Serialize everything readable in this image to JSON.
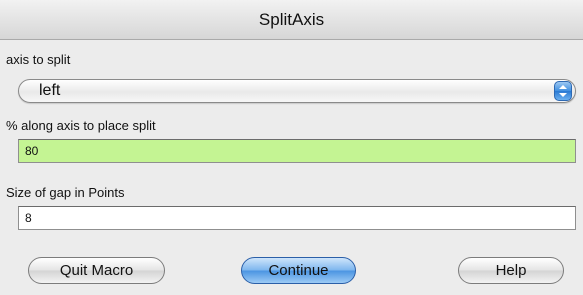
{
  "window": {
    "title": "SplitAxis"
  },
  "form": {
    "axis_label": "axis to split",
    "axis_value": "left",
    "percent_label": "% along axis to place split",
    "percent_value": "80",
    "gap_label": "Size of gap in Points",
    "gap_value": "8"
  },
  "buttons": {
    "quit": "Quit Macro",
    "continue": "Continue",
    "help": "Help"
  },
  "colors": {
    "active_field": "#c4f493",
    "default_button": "#4c95e2"
  },
  "icons": {
    "popup": "updown-arrows-icon"
  }
}
